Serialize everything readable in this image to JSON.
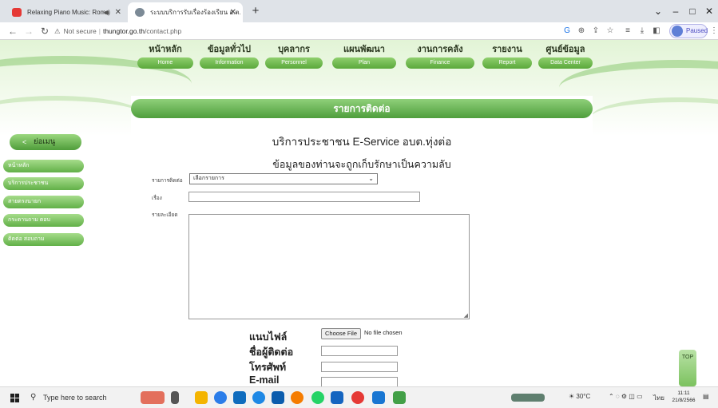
{
  "browser": {
    "tabs": [
      {
        "title": "Relaxing Piano Music: Roma",
        "active": false,
        "favicon_color": "#e53935"
      },
      {
        "title": "ระบบบริการรับเรื่องร้องเรียน อ.ต.",
        "active": true,
        "favicon_color": "#7c8a96"
      }
    ],
    "new_tab": "+",
    "address": {
      "security_label": "Not secure",
      "host": "thungtor.go.th",
      "path": "/contact.php"
    },
    "profile_status": "Paused"
  },
  "site_menu": [
    {
      "th": "หน้าหลัก",
      "en": "Home"
    },
    {
      "th": "ข้อมูลทั่วไป",
      "en": "Information"
    },
    {
      "th": "บุคลากร",
      "en": "Personnel"
    },
    {
      "th": "แผนพัฒนา",
      "en": "Plan"
    },
    {
      "th": "งานการคลัง",
      "en": "Finance"
    },
    {
      "th": "รายงาน",
      "en": "Report"
    },
    {
      "th": "ศูนย์ข้อมูล",
      "en": "Data Center"
    }
  ],
  "sidebar": {
    "heading": "ย่อเมนู",
    "items": [
      {
        "label": "หน้าหลัก"
      },
      {
        "label": "บริการประชาชน"
      },
      {
        "label": "สายตรงนายก"
      },
      {
        "label": "กระดานถาม ตอบ"
      },
      {
        "label": "ติดต่อ สอบถาม"
      }
    ]
  },
  "form": {
    "section_title": "รายการติดต่อ",
    "service_heading": "บริการประชาชน E-Service อบต.ทุ่งต่อ",
    "privacy_notice": "ข้อมูลของท่านจะถูกเก็บรักษาเป็นความลับ",
    "contact_type_label": "รายการติดต่อ",
    "contact_type_value": "เลือกรายการ",
    "subject_label": "เรื่อง",
    "detail_label": "รายละเอียด",
    "attach_label": "แนบไฟล์",
    "choose_file": "Choose File",
    "file_status": "No file chosen",
    "contact_name_label": "ชื่อผู้ติดต่อ",
    "phone_label": "โทรศัพท์",
    "email_label": "E-mail"
  },
  "scroll_widget": "TOP",
  "taskbar": {
    "search_placeholder": "Type here to search",
    "weather": "30°C",
    "language": "ไทย",
    "time": "11:11",
    "date": "21/8/2566"
  }
}
